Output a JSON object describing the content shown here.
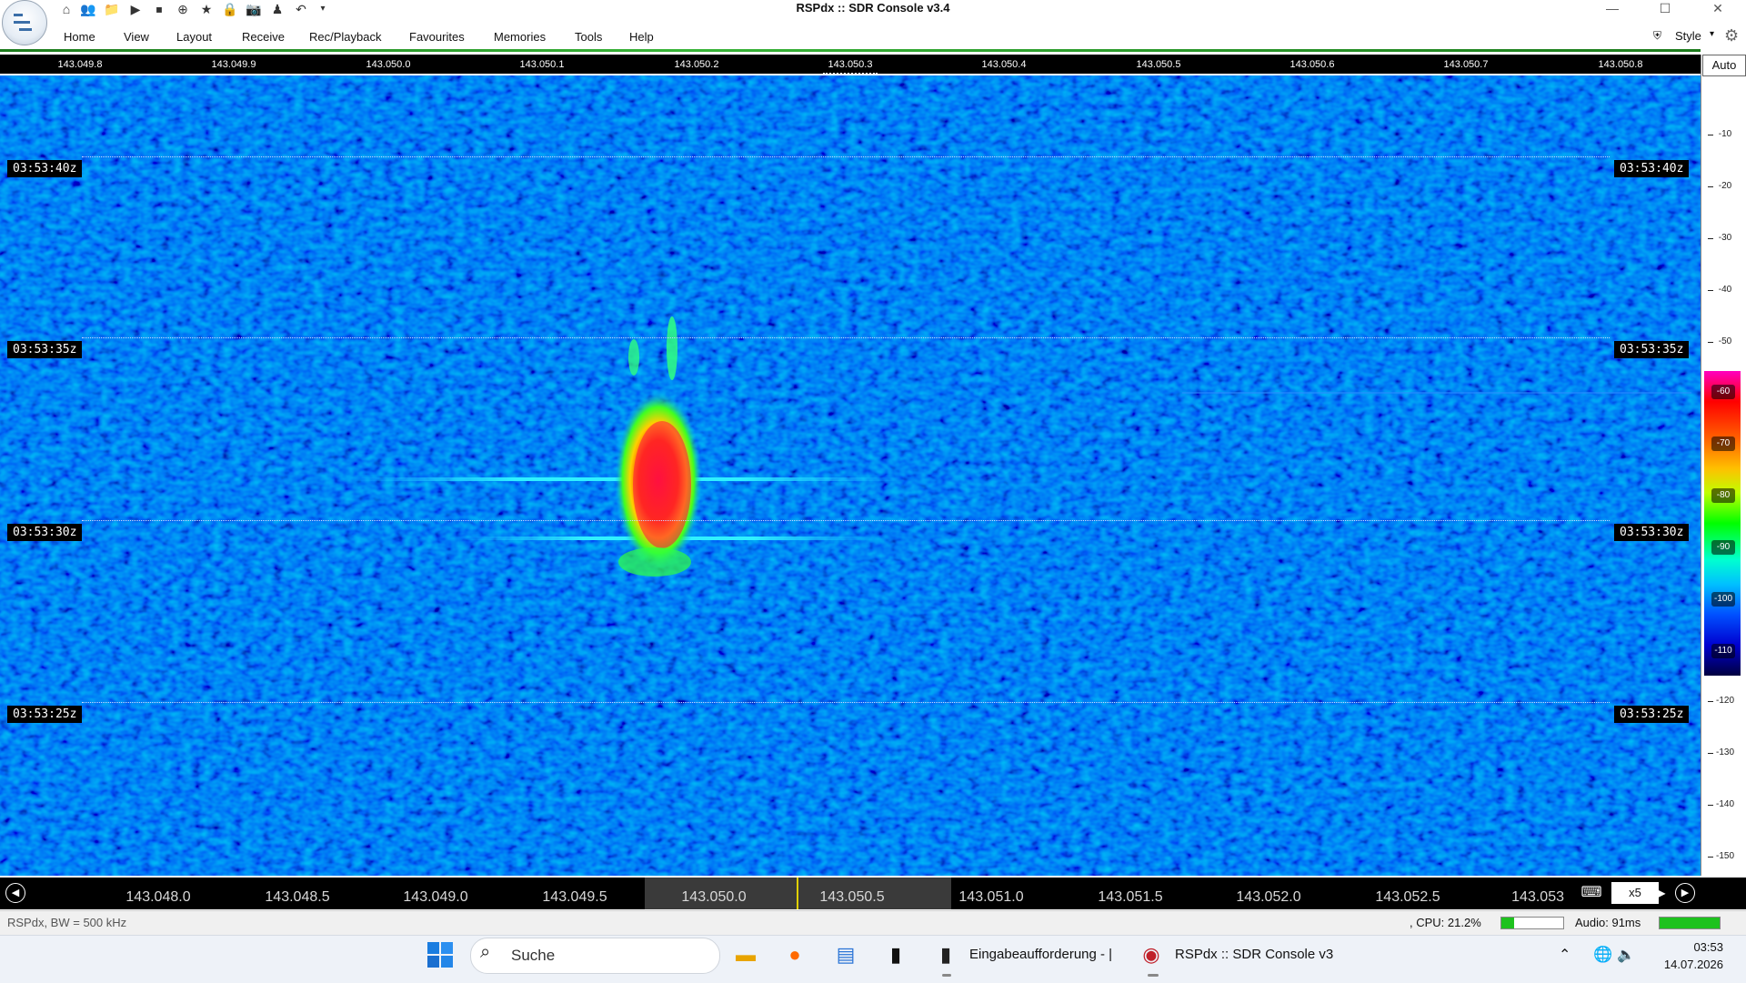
{
  "window": {
    "title": "RSPdx :: SDR Console v3.4",
    "controls": {
      "minimize": "—",
      "maximize": "☐",
      "close": "✕"
    }
  },
  "toolbar": {
    "style_label": "Style"
  },
  "menu": {
    "items": [
      "Home",
      "View",
      "Layout",
      "Receive",
      "Rec/Playback",
      "Favourites",
      "Memories",
      "Tools",
      "Help"
    ]
  },
  "top_scale": {
    "ticks": [
      "143.049.8",
      "143.049.9",
      "143.050.0",
      "143.050.1",
      "143.050.2",
      "143.050.3",
      "143.050.4",
      "143.050.5",
      "143.050.6",
      "143.050.7",
      "143.050.8"
    ]
  },
  "waterfall": {
    "time_labels": [
      "03:53:40z",
      "03:53:35z",
      "03:53:30z",
      "03:53:25z"
    ]
  },
  "db_scale": {
    "auto_label": "Auto",
    "ticks": [
      "-10",
      "-20",
      "-30",
      "-40",
      "-50",
      "-60",
      "-70",
      "-80",
      "-90",
      "-100",
      "-110",
      "-120",
      "-130",
      "-140",
      "-150"
    ]
  },
  "bottom_scale": {
    "ticks": [
      "143.048.0",
      "143.048.5",
      "143.049.0",
      "143.049.5",
      "143.050.0",
      "143.050.5",
      "143.051.0",
      "143.051.5",
      "143.052.0",
      "143.052.5",
      "143.053"
    ],
    "zoom": "x5"
  },
  "status": {
    "left": "RSPdx, BW = 500 kHz",
    "cpu": ", CPU: 21.2%",
    "cpu_level": 0.2,
    "audio": "Audio: 91ms",
    "audio_level": 1.0
  },
  "taskbar": {
    "search_placeholder": "Suche",
    "apps": [
      {
        "name": "Eingabeaufforderung - |"
      },
      {
        "name": "RSPdx :: SDR Console v3"
      }
    ],
    "clock_time": "03:53",
    "clock_date": "14.07.2026"
  },
  "colors": {
    "accent_green": "#1ec21e",
    "waterfall_bg": "#06104a"
  }
}
